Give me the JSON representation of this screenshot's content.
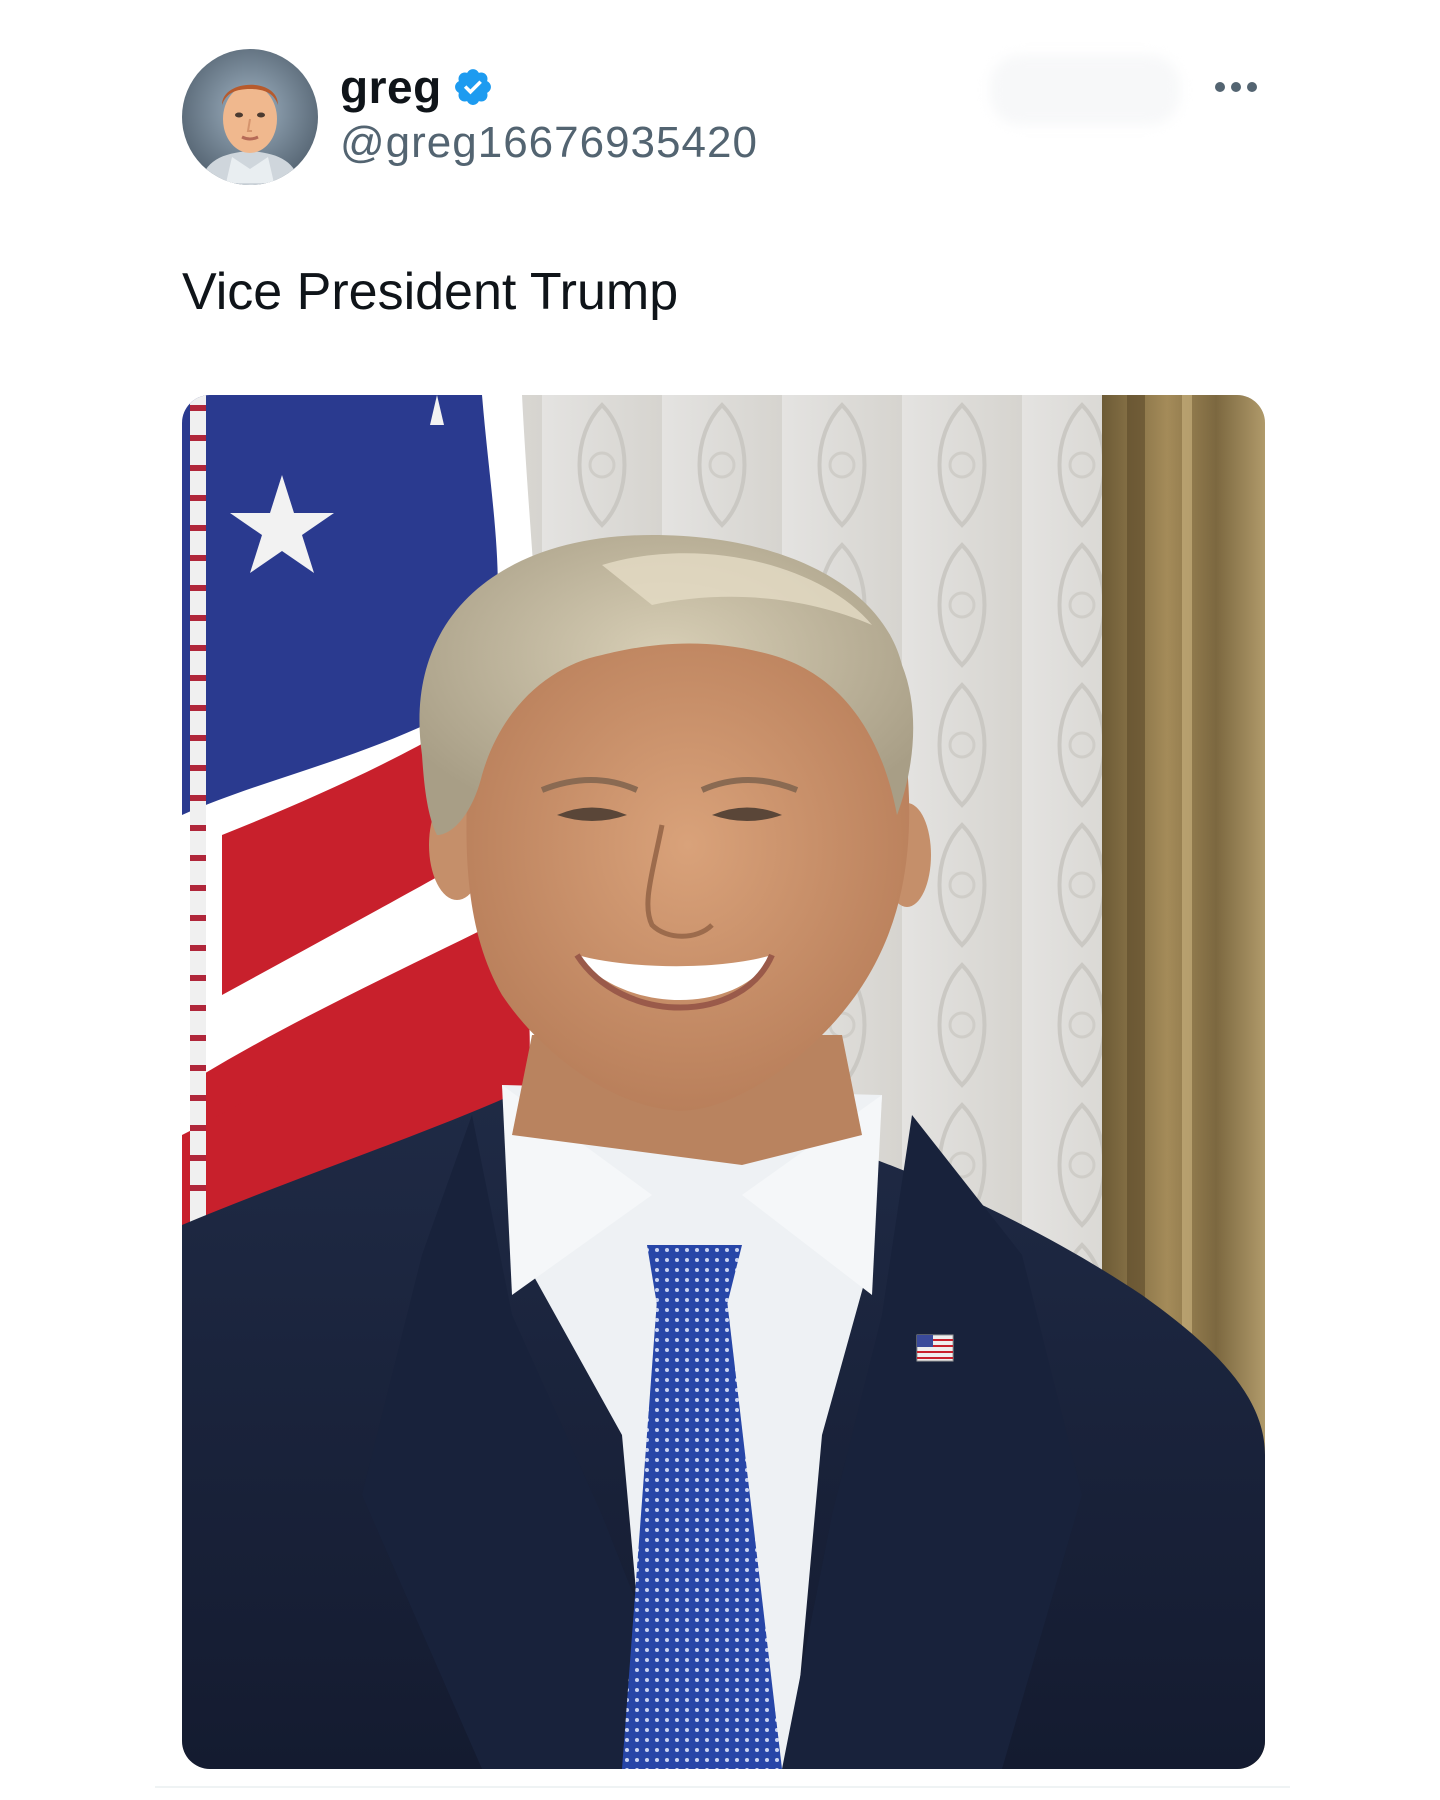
{
  "tweet": {
    "author": {
      "display_name": "greg",
      "handle": "@greg16676935420",
      "verified": true,
      "avatar_icon": "profile-photo",
      "verified_icon": "verified-badge-icon",
      "verified_color": "#1d9bf0"
    },
    "more_icon": "more-options-icon",
    "text": "Vice President Trump",
    "media": {
      "kind": "photo",
      "description_icon": "portrait-photo"
    }
  },
  "colors": {
    "text_primary": "#0f1419",
    "text_secondary": "#536471",
    "background": "#ffffff"
  }
}
